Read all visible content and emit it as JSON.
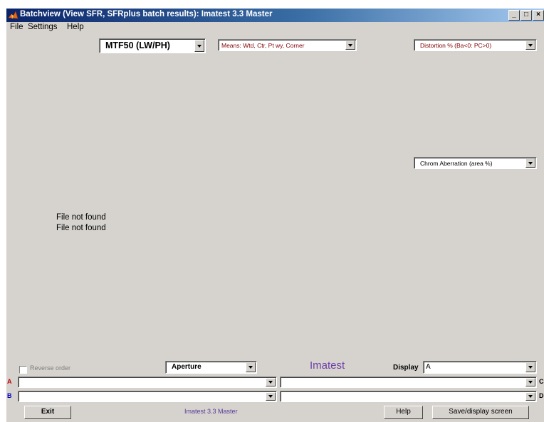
{
  "window": {
    "title": "Batchview (View SFR, SFRplus batch results): Imatest 3.3  Master",
    "controls": [
      "_",
      "□",
      "×"
    ]
  },
  "menu": [
    "File",
    "Settings",
    "Help"
  ],
  "selectors": {
    "mtf": "MTF50 (LW/PH)",
    "means": "Means: Wtd, Ctr, Pt wy, Corner",
    "distortion": "Distortion %  (Ba<0: PC>0)",
    "chrom": "Chrom Aberration (area %)"
  },
  "status": {
    "line1": "File not found",
    "line2": "File not found"
  },
  "bottom": {
    "reverse_order": "Reverse order",
    "aperture": "Aperture",
    "brand": "Imatest",
    "display_label": "Display",
    "display_value": "A",
    "row_a": "A",
    "row_b": "B",
    "row_c": "C",
    "row_d": "D",
    "exit": "Exit",
    "version": "Imatest 3.3 Master",
    "help": "Help",
    "save": "Save/display screen"
  },
  "colors": {
    "brand": "#6d3fa8",
    "accent_text": "#800000",
    "title_bar": "#0a246a"
  },
  "icons": [
    "matlab-icon",
    "minimize-icon",
    "maximize-icon",
    "close-icon",
    "dropdown-arrow-icon",
    "checkbox-icon"
  ]
}
